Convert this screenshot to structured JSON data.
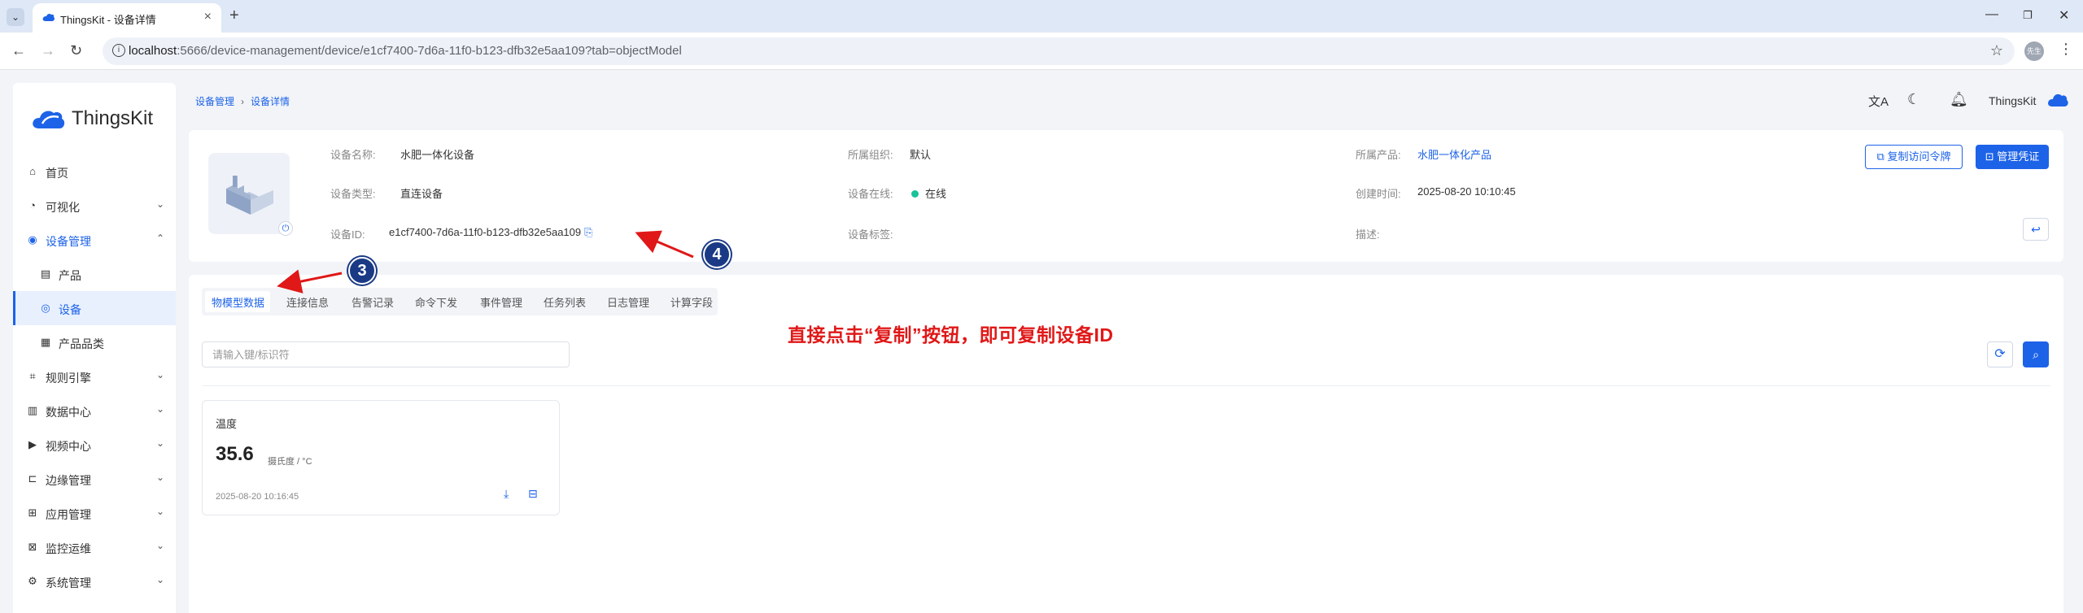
{
  "browser": {
    "tab_title": "ThingsKit - 设备详情",
    "url_host": "localhost",
    "url_rest": ":5666/device-management/device/e1cf7400-7d6a-11f0-b123-dfb32e5aa109?tab=objectModel",
    "profile_label": "先生"
  },
  "app": {
    "logo_text": "ThingsKit",
    "user_name": "ThingsKit",
    "brand_color": "#1d63e8"
  },
  "sidebar": {
    "items": [
      {
        "label": "首页",
        "icon": "home-icon"
      },
      {
        "label": "可视化",
        "icon": "dashboard-icon"
      },
      {
        "label": "设备管理",
        "icon": "device-icon"
      },
      {
        "label": "产品",
        "icon": "product-icon"
      },
      {
        "label": "设备",
        "icon": "device-sub-icon"
      },
      {
        "label": "产品品类",
        "icon": "category-icon"
      },
      {
        "label": "规则引擎",
        "icon": "rule-icon"
      },
      {
        "label": "数据中心",
        "icon": "chart-icon"
      },
      {
        "label": "视频中心",
        "icon": "video-icon"
      },
      {
        "label": "边缘管理",
        "icon": "edge-icon"
      },
      {
        "label": "应用管理",
        "icon": "app-icon"
      },
      {
        "label": "监控运维",
        "icon": "monitor-icon"
      },
      {
        "label": "系统管理",
        "icon": "gear-icon"
      }
    ]
  },
  "breadcrumb": {
    "parent": "设备管理",
    "current": "设备详情"
  },
  "device": {
    "name_label": "设备名称:",
    "name": "水肥一体化设备",
    "org_label": "所属组织:",
    "org": "默认",
    "product_label": "所属产品:",
    "product": "水肥一体化产品",
    "type_label": "设备类型:",
    "type": "直连设备",
    "online_label": "设备在线:",
    "online": "在线",
    "created_label": "创建时间:",
    "created": "2025-08-20 10:10:45",
    "id_label": "设备ID:",
    "id": "e1cf7400-7d6a-11f0-b123-dfb32e5aa109",
    "tags_label": "设备标签:",
    "desc_label": "描述:"
  },
  "actions": {
    "copy_token": "复制访问令牌",
    "manage_cred": "管理凭证"
  },
  "tabs": [
    "物模型数据",
    "连接信息",
    "告警记录",
    "命令下发",
    "事件管理",
    "任务列表",
    "日志管理",
    "计算字段"
  ],
  "search": {
    "placeholder": "请输入键/标识符"
  },
  "metric": {
    "name": "温度",
    "value": "35.6",
    "unit": "摄氏度 / °C",
    "time": "2025-08-20 10:16:45"
  },
  "annotation": {
    "text": "直接点击“复制”按钮，即可复制设备ID",
    "badge_3": "3",
    "badge_4": "4",
    "color": "#e01818"
  }
}
